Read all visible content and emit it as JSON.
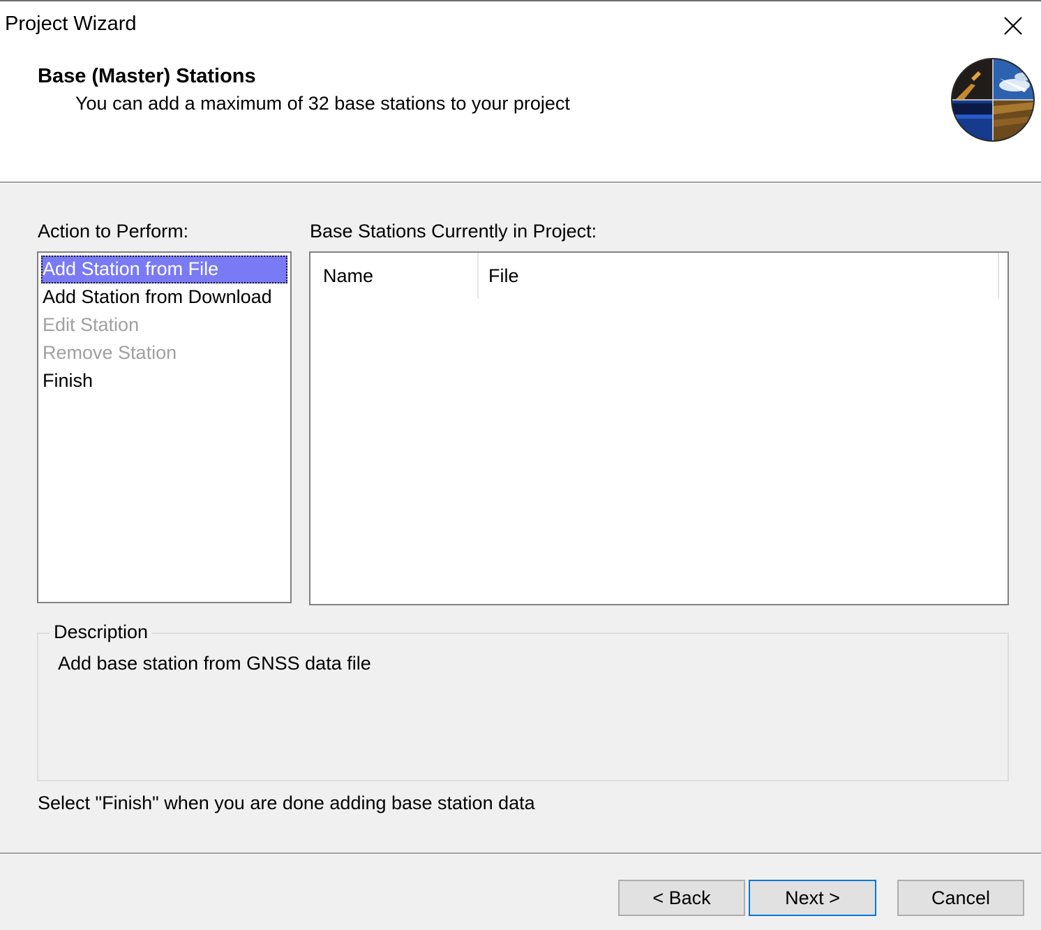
{
  "window": {
    "title": "Project Wizard"
  },
  "header": {
    "heading": "Base (Master) Stations",
    "subheading": "You can add a maximum of 32 base stations to your project",
    "logo_icon": "gps-satellite-globe-icon"
  },
  "actions": {
    "label": "Action to Perform:",
    "items": [
      {
        "label": "Add Station from File",
        "selected": true,
        "enabled": true
      },
      {
        "label": "Add Station from Download",
        "selected": false,
        "enabled": true
      },
      {
        "label": "Edit Station",
        "selected": false,
        "enabled": false
      },
      {
        "label": "Remove Station",
        "selected": false,
        "enabled": false
      },
      {
        "label": "Finish",
        "selected": false,
        "enabled": true
      }
    ]
  },
  "stations": {
    "label": "Base Stations Currently in Project:",
    "columns": [
      "Name",
      "File"
    ],
    "rows": []
  },
  "description": {
    "legend": "Description",
    "text": "Add base station from GNSS data file"
  },
  "hint": "Select \"Finish\" when you are done adding base station data",
  "buttons": {
    "back": "< Back",
    "next": "Next >",
    "cancel": "Cancel"
  },
  "colors": {
    "selection": "#7a7af5",
    "default_button_border": "#0078d7",
    "disabled_text": "#a0a0a0"
  }
}
